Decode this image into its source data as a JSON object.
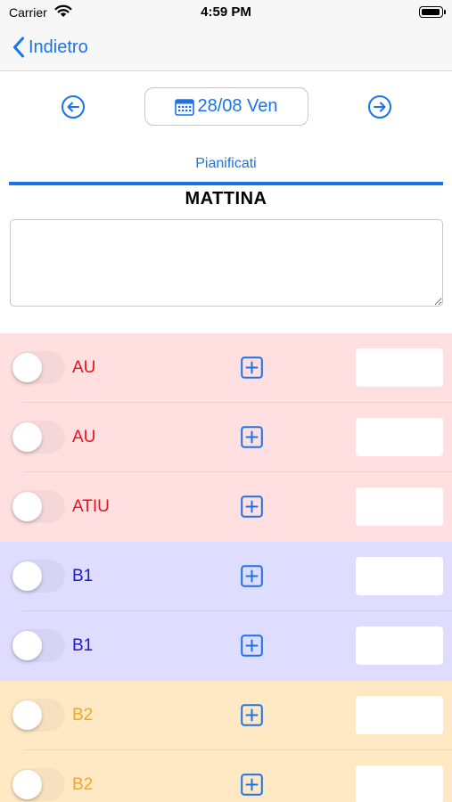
{
  "status_bar": {
    "carrier": "Carrier",
    "time": "4:59 PM"
  },
  "nav": {
    "back_label": "Indietro"
  },
  "date_nav": {
    "date_label": "28/08 Ven"
  },
  "tabs": [
    {
      "label": "Pianificati",
      "selected": true
    }
  ],
  "section": {
    "title": "MATTINA",
    "notes_value": ""
  },
  "colors": {
    "accent": "#1a73e8",
    "group_red_bg": "#ffdfdf",
    "group_red_text": "#e8141c",
    "group_blue_bg": "#dedcff",
    "group_blue_text": "#1b16d6",
    "group_orange_bg": "#ffe9c4",
    "group_orange_text": "#f0a81c"
  },
  "rows": [
    {
      "label": "AU",
      "group": "red",
      "toggle_on": false,
      "quantity": ""
    },
    {
      "label": "AU",
      "group": "red",
      "toggle_on": false,
      "quantity": ""
    },
    {
      "label": "ATIU",
      "group": "red",
      "toggle_on": false,
      "quantity": ""
    },
    {
      "label": "B1",
      "group": "blue",
      "toggle_on": false,
      "quantity": ""
    },
    {
      "label": "B1",
      "group": "blue",
      "toggle_on": false,
      "quantity": ""
    },
    {
      "label": "B2",
      "group": "orange",
      "toggle_on": false,
      "quantity": ""
    },
    {
      "label": "B2",
      "group": "orange",
      "toggle_on": false,
      "quantity": ""
    }
  ],
  "icons": {
    "back": "chevron-left-icon",
    "prev": "arrow-left-circle-icon",
    "next": "arrow-right-circle-icon",
    "calendar": "calendar-icon",
    "add": "plus-square-icon"
  }
}
